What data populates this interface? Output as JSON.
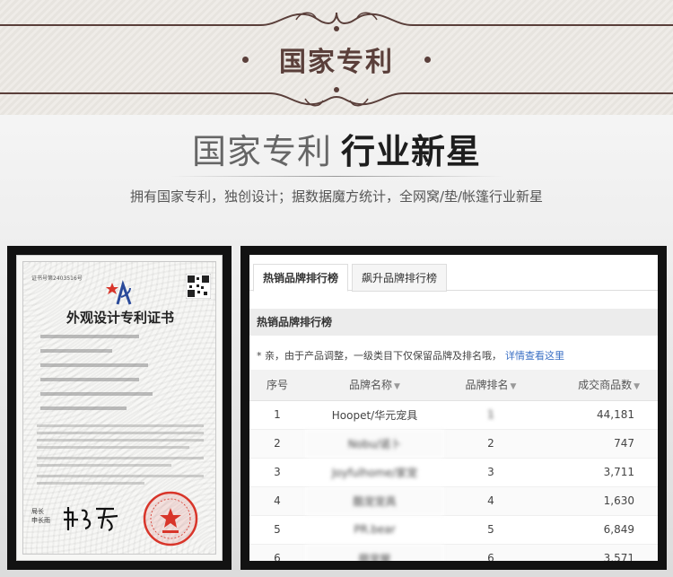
{
  "banner": {
    "title": "国家专利"
  },
  "headline": {
    "part1": "国家专利",
    "part2": "行业新星"
  },
  "tagline": "拥有国家专利，独创设计；据数据魔方统计，全网窝/垫/帐篷行业新星",
  "certificate": {
    "number_text": "证书号第2403516号",
    "title": "外观设计专利证书",
    "signature_label": "局长 申长雨",
    "signature_title_lines": [
      "局长",
      "申长雨"
    ],
    "seal_text": "中华人民共和国国家知识产权局"
  },
  "ranking": {
    "tabs": [
      {
        "label": "热销品牌排行榜",
        "active": true
      },
      {
        "label": "飙升品牌排行榜",
        "active": false
      }
    ],
    "section_title": "热销品牌排行榜",
    "notice": "* 亲，由于产品调整，一级类目下仅保留品牌及排名哦，",
    "notice_link": "详情查看这里",
    "columns": [
      "序号",
      "品牌名称",
      "品牌排名",
      "成交商品数"
    ],
    "rows": [
      {
        "index": "1",
        "brand": "Hoopet/华元宠具",
        "rank": "1",
        "count": "44,181",
        "blurred": false,
        "rank_blurred": true
      },
      {
        "index": "2",
        "brand": "Nobu/诺卜",
        "rank": "2",
        "count": "747",
        "blurred": true,
        "rank_blurred": false
      },
      {
        "index": "3",
        "brand": "Joyfulhome/家宠",
        "rank": "3",
        "count": "3,711",
        "blurred": true,
        "rank_blurred": false
      },
      {
        "index": "4",
        "brand": "酷宠宠具",
        "rank": "4",
        "count": "1,630",
        "blurred": true,
        "rank_blurred": false
      },
      {
        "index": "5",
        "brand": "PR.bear",
        "rank": "5",
        "count": "6,849",
        "blurred": true,
        "rank_blurred": false
      },
      {
        "index": "6",
        "brand": "萌宠屋",
        "rank": "6",
        "count": "3,571",
        "blurred": true,
        "rank_blurred": false
      }
    ]
  },
  "colors": {
    "banner_text": "#5a3f3a",
    "link": "#3a6fc4",
    "seal_red": "#d8352a"
  }
}
